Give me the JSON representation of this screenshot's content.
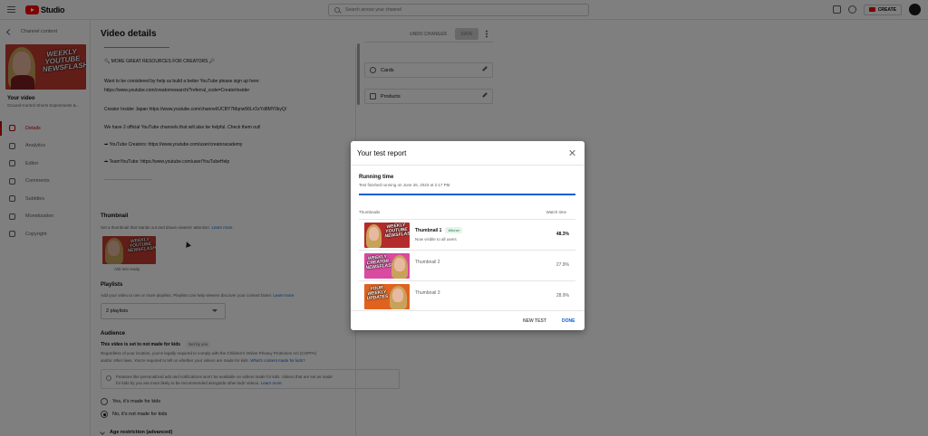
{
  "app": {
    "logo_text": "Studio",
    "search_placeholder": "Search across your channel",
    "create_label": "CREATE"
  },
  "sidebar": {
    "back_label": "Channel content",
    "thumb_text": "WEEKLY YOUTUBE NEWSFLASH",
    "your_video": "Your video",
    "video_sub": "Ground-Control Shorts Experiments &...",
    "items": [
      {
        "label": "Details",
        "icon": "pencil-icon",
        "active": true
      },
      {
        "label": "Analytics",
        "icon": "analytics-icon",
        "active": false
      },
      {
        "label": "Editor",
        "icon": "editor-icon",
        "active": false
      },
      {
        "label": "Comments",
        "icon": "comments-icon",
        "active": false
      },
      {
        "label": "Subtitles",
        "icon": "subtitles-icon",
        "active": false
      },
      {
        "label": "Monetization",
        "icon": "monetization-icon",
        "active": false
      },
      {
        "label": "Copyright",
        "icon": "copyright-icon",
        "active": false
      }
    ]
  },
  "main": {
    "title": "Video details",
    "undo_label": "UNDO CHANGES",
    "save_label": "SAVE",
    "description_lines": [
      "🔍 MORE GREAT RESOURCES FOR CREATORS 🔎",
      "Want to be considered by help us build a better YouTube please sign up here:",
      "https://www.youtube.com/creatorresearch/?referral_code=CreatorInsider",
      "Creator Insider Japan https://www.youtube.com/channel/UCBY7Mqnw56LrOzYd8MY0kyQ/",
      "We have 2 official YouTube channels that will also be helpful. Check them out!",
      "➡ YouTube Creators: https://www.youtube.com/user/creatoracademy",
      "➡ TeamYouTube: https://www.youtube.com/user/YouTubeHelp",
      "___________________"
    ],
    "thumbnail": {
      "title": "Thumbnail",
      "sub": "Set a thumbnail that stands out and draws viewers' attention.",
      "link": "Learn more",
      "caption": "A/B test ready"
    },
    "playlists": {
      "title": "Playlists",
      "sub": "Add your video to one or more playlists. Playlists can help viewers discover your content faster.",
      "link": "Learn more",
      "value": "2 playlists"
    },
    "audience": {
      "title": "Audience",
      "kids_note": "This video is set to not made for kids",
      "chip": "Set by you",
      "para1": "Regardless of your location, you're legally required to comply with the Children's Online Privacy Protection Act (COPPA)",
      "para2": "and/or other laws. You're required to tell us whether your videos are made for kids.",
      "para2_link": "What's content made for kids?",
      "info1": "Features like personalized ads and notifications won't be available on videos made for kids. Videos that are set as made",
      "info2": "for kids by you are more likely to be recommended alongside other kids' videos.",
      "info_link": "Learn more",
      "options": [
        "Yes, it's made for kids",
        "No, it's not made for kids"
      ],
      "age_restriction": "Age restriction (advanced)"
    },
    "right_cards": [
      {
        "label": "Cards",
        "icon": "cards-icon"
      },
      {
        "label": "Products",
        "icon": "products-icon"
      }
    ]
  },
  "modal": {
    "title": "Your test report",
    "running_label": "Running time",
    "running_sub": "Test finished running on June 26, 2023 at 2:17 PM",
    "progress": 1.0,
    "col_thumbnails": "Thumbnails",
    "col_watch": "Watch time",
    "rows": [
      {
        "name": "Thumbnail 1",
        "badge": "Winner",
        "note": "Now visible to all users",
        "value": "48.3%",
        "art": "WEEKLY YOUTUBE NEWSFLASH",
        "winner": true
      },
      {
        "name": "Thumbnail 2",
        "badge": "",
        "note": "",
        "value": "27.9%",
        "art": "WEEKLY CREATOR NEWSFLASH",
        "winner": false
      },
      {
        "name": "Thumbnail 3",
        "badge": "",
        "note": "",
        "value": "28.9%",
        "art": "YOUR WEEKLY UPDATES",
        "winner": false
      }
    ],
    "new_test_label": "NEW TEST",
    "done_label": "DONE"
  }
}
